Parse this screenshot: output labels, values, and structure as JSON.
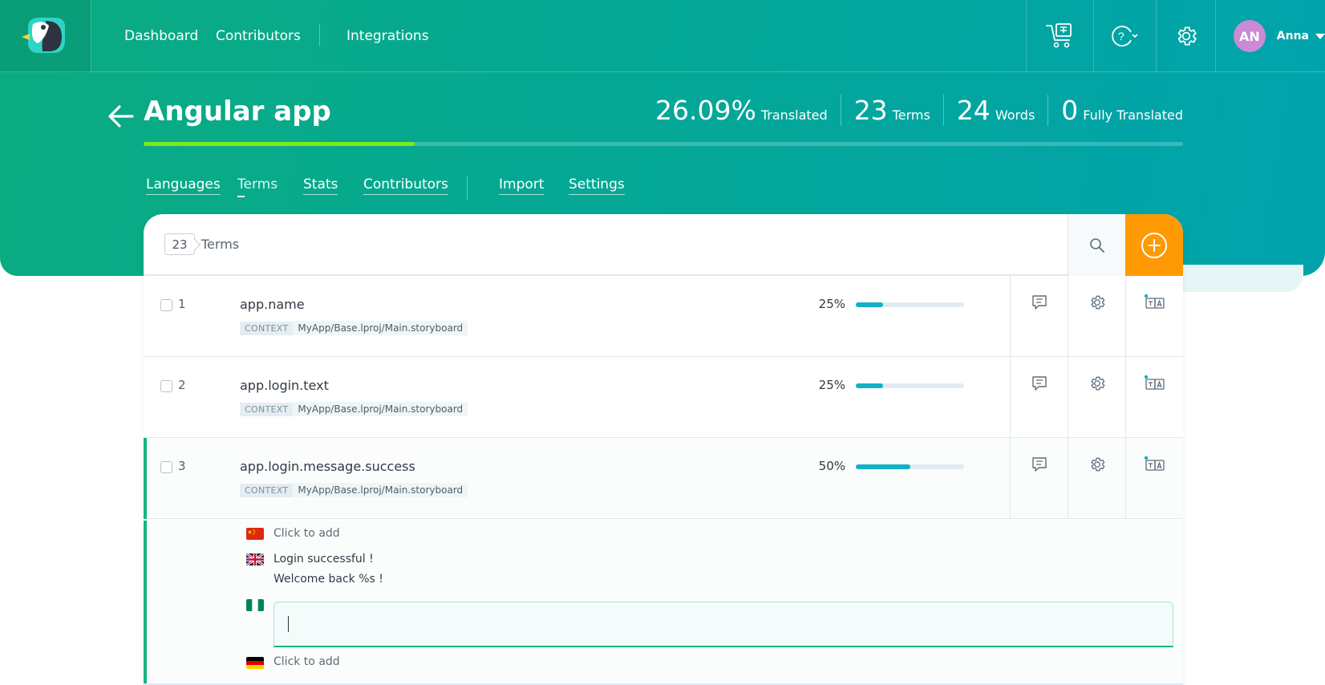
{
  "nav": {
    "dashboard": "Dashboard",
    "contributors": "Contributors",
    "integrations": "Integrations"
  },
  "user": {
    "initials": "AN",
    "name": "Anna"
  },
  "project": {
    "title": "Angular app",
    "progress_fraction": 0.2609,
    "stats": {
      "translated_value": "26.09%",
      "translated_label": "Translated",
      "terms_value": "23",
      "terms_label": "Terms",
      "words_value": "24",
      "words_label": "Words",
      "fully_value": "0",
      "fully_label": "Fully Translated"
    }
  },
  "tabs": {
    "languages": "Languages",
    "terms": "Terms",
    "stats": "Stats",
    "contributors": "Contributors",
    "import": "Import",
    "settings": "Settings",
    "active": "Terms"
  },
  "terms_header": {
    "count": "23",
    "label": "Terms"
  },
  "terms": [
    {
      "num": "1",
      "name": "app.name",
      "context_tag": "CONTEXT",
      "context": "MyApp/Base.lproj/Main.storyboard",
      "percent": "25%",
      "progress": 0.25
    },
    {
      "num": "2",
      "name": "app.login.text",
      "context_tag": "CONTEXT",
      "context": "MyApp/Base.lproj/Main.storyboard",
      "percent": "25%",
      "progress": 0.25
    },
    {
      "num": "3",
      "name": "app.login.message.success",
      "context_tag": "CONTEXT",
      "context": "MyApp/Base.lproj/Main.storyboard",
      "percent": "50%",
      "progress": 0.5,
      "expanded": true
    }
  ],
  "translations": [
    {
      "flag": "china-flag",
      "text": "Click to add"
    },
    {
      "flag": "uk-flag",
      "line1": "Login successful !",
      "line2": "Welcome back %s !"
    },
    {
      "flag": "nigeria-flag",
      "value": ""
    },
    {
      "flag": "germany-flag",
      "text": "Click to add"
    }
  ],
  "colors": {
    "brand_green": "#0bab80",
    "brand_teal": "#00a3ad",
    "accent_orange": "#ff9a05",
    "progress_green": "#7fe81e",
    "term_progress": "#13b1c6"
  }
}
